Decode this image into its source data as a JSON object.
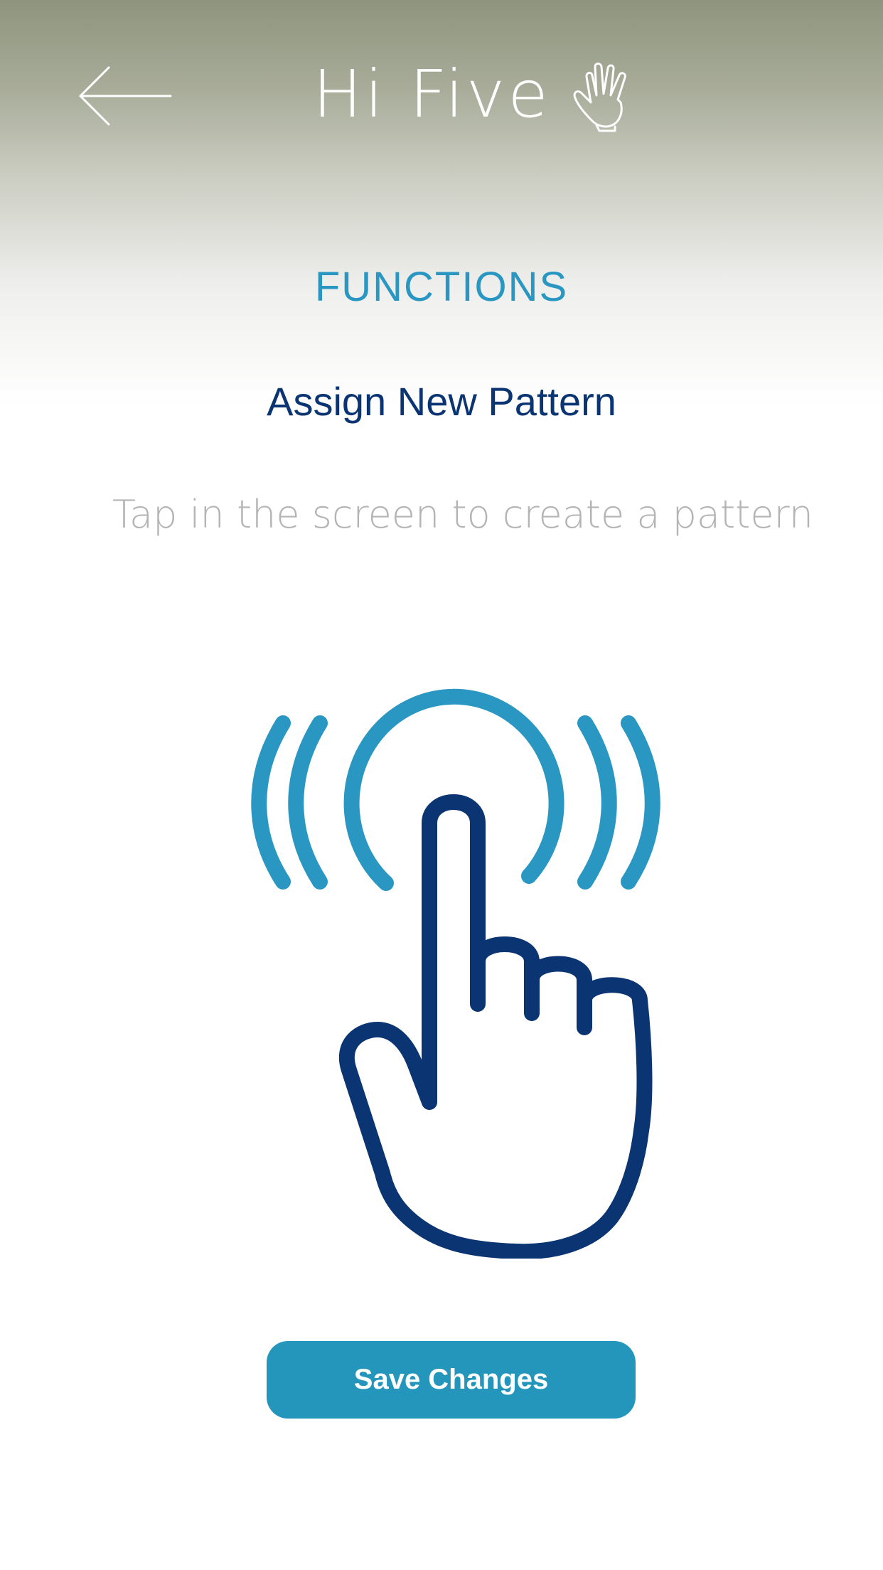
{
  "header": {
    "back_icon": "arrow-left-icon",
    "app_title": "Hi Five",
    "logo_icon": "raised-hand-icon"
  },
  "section_title": "FUNCTIONS",
  "page_title": "Assign New Pattern",
  "instruction": "Tap in the screen to create a pattern",
  "tap_illustration": {
    "icon": "finger-tap-icon",
    "colors": {
      "waves": "#2a97c3",
      "hand": "#0b3472"
    }
  },
  "save_button": {
    "label": "Save Changes",
    "color": "#2496bb"
  },
  "colors": {
    "accent": "#2a97c3",
    "primary": "#0b3472",
    "muted_text": "#b4b4b4",
    "header_top": "#8e947e"
  }
}
